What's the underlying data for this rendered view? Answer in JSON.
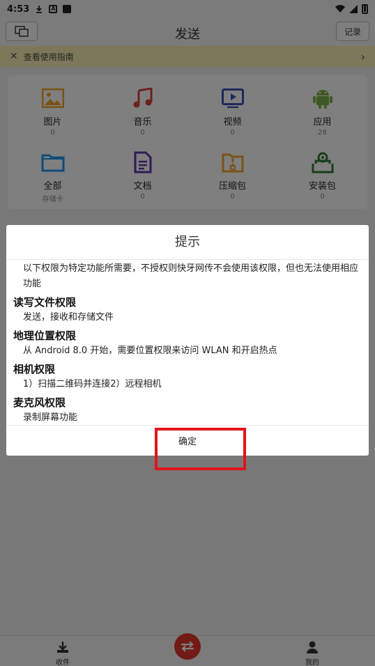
{
  "status_bar": {
    "time": "4:53"
  },
  "title_bar": {
    "title": "发送",
    "record_label": "记录"
  },
  "guide": {
    "text": "查看使用指南"
  },
  "categories": [
    {
      "name": "图片",
      "count": "0",
      "icon": "image-icon",
      "color": "#f0a62a"
    },
    {
      "name": "音乐",
      "count": "0",
      "icon": "music-icon",
      "color": "#d6433b"
    },
    {
      "name": "视频",
      "count": "0",
      "icon": "video-icon",
      "color": "#3f51b5"
    },
    {
      "name": "应用",
      "count": "28",
      "icon": "android-icon",
      "color": "#7cb342"
    },
    {
      "name": "全部",
      "count": "存储卡",
      "icon": "folder-icon",
      "color": "#2196f3"
    },
    {
      "name": "文档",
      "count": "0",
      "icon": "document-icon",
      "color": "#5e35b1"
    },
    {
      "name": "压缩包",
      "count": "0",
      "icon": "zip-icon",
      "color": "#f0a62a"
    },
    {
      "name": "安装包",
      "count": "0",
      "icon": "package-icon",
      "color": "#2e7d32"
    }
  ],
  "dialog": {
    "title": "提示",
    "intro": "以下权限为特定功能所需要，不授权则快牙网传不会使用该权限，但也无法使用相应功能",
    "sections": [
      {
        "heading": "读写文件权限",
        "text": "发送，接收和存储文件"
      },
      {
        "heading": "地理位置权限",
        "text": "从 Android 8.0 开始，需要位置权限来访问 WLAN 和开启热点"
      },
      {
        "heading": "相机权限",
        "text": "1）扫描二维码并连接2）远程相机"
      },
      {
        "heading": "麦克风权限",
        "text": "录制屏幕功能"
      }
    ],
    "ok_label": "确定"
  },
  "bottom_nav": {
    "receive_label": "收件",
    "me_label": "我的"
  },
  "colors": {
    "accent": "#e4352b",
    "highlight": "#e4141b",
    "guide_bg": "#fbf0b6"
  }
}
